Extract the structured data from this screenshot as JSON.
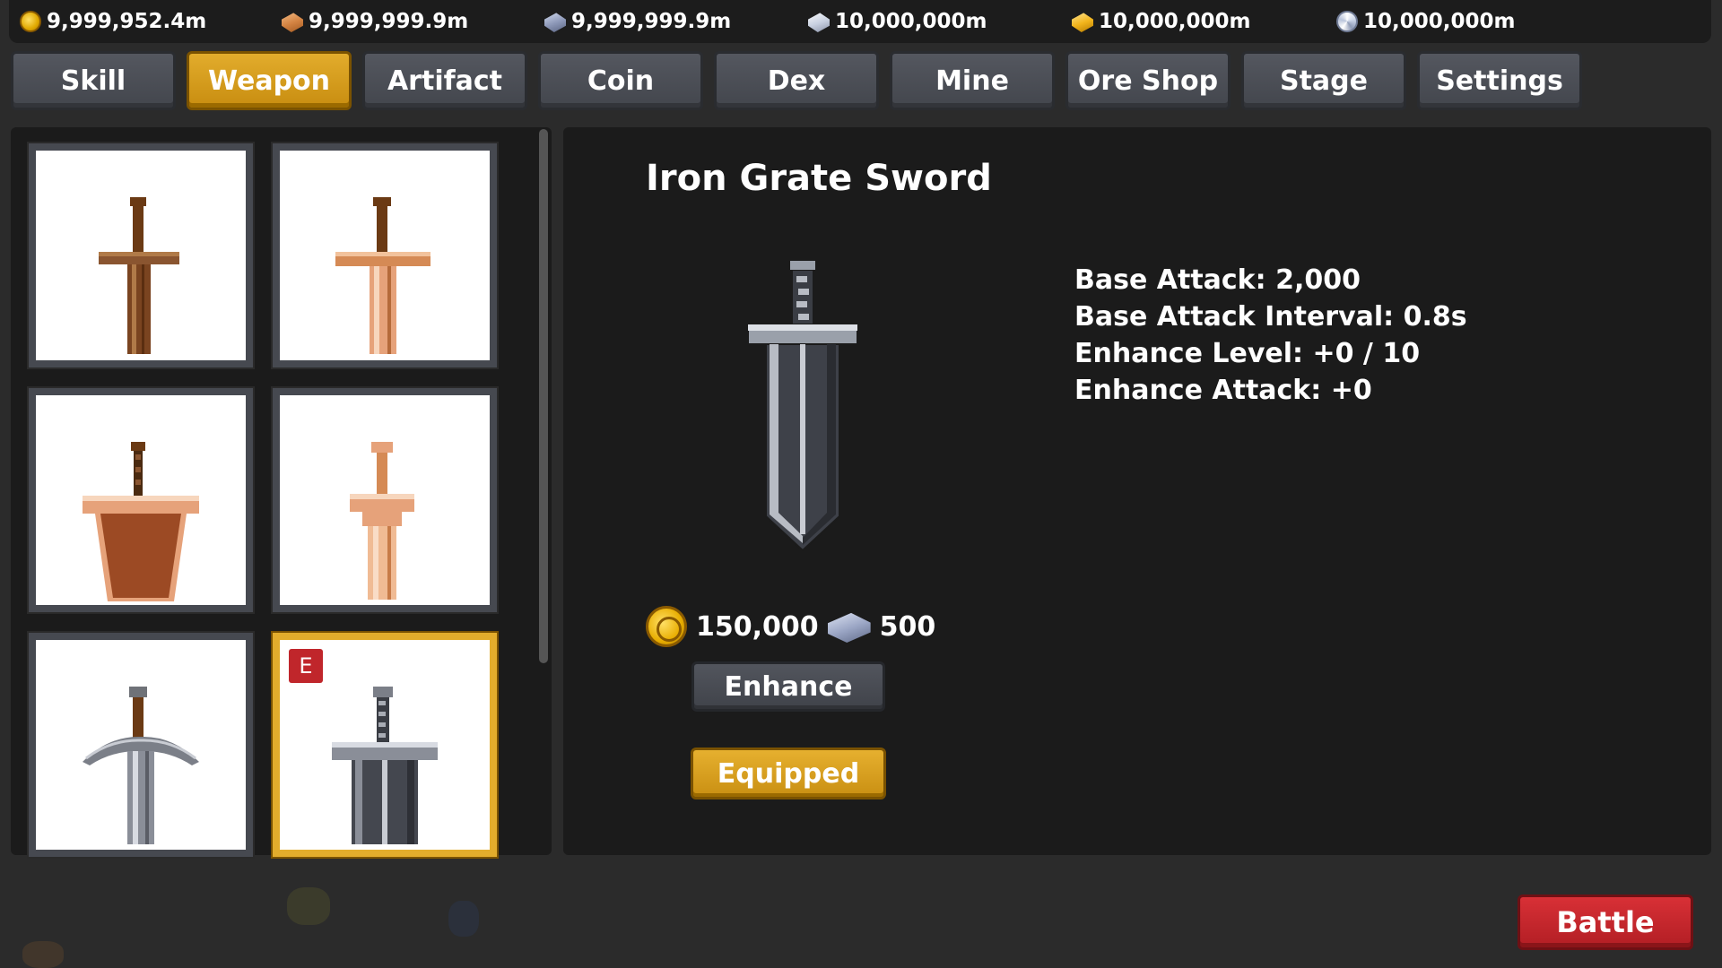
{
  "resources": [
    {
      "icon": "coin-icon",
      "value": "9,999,952.4m"
    },
    {
      "icon": "copper-ore-icon",
      "value": "9,999,999.9m"
    },
    {
      "icon": "iron-ore-icon",
      "value": "9,999,999.9m"
    },
    {
      "icon": "silver-ore-icon",
      "value": "10,000,000m"
    },
    {
      "icon": "gold-ore-icon",
      "value": "10,000,000m"
    },
    {
      "icon": "diamond-icon",
      "value": "10,000,000m"
    }
  ],
  "tabs": [
    {
      "label": "Skill",
      "active": false
    },
    {
      "label": "Weapon",
      "active": true
    },
    {
      "label": "Artifact",
      "active": false
    },
    {
      "label": "Coin",
      "active": false
    },
    {
      "label": "Dex",
      "active": false
    },
    {
      "label": "Mine",
      "active": false
    },
    {
      "label": "Ore Shop",
      "active": false
    },
    {
      "label": "Stage",
      "active": false
    },
    {
      "label": "Settings",
      "active": false
    }
  ],
  "inventory": [
    {
      "icon": "wooden-sword-icon",
      "selected": false,
      "equipped": false
    },
    {
      "icon": "copper-sword-icon",
      "selected": false,
      "equipped": false
    },
    {
      "icon": "copper-broadsword-icon",
      "selected": false,
      "equipped": false
    },
    {
      "icon": "bronze-sword-icon",
      "selected": false,
      "equipped": false
    },
    {
      "icon": "iron-sword-icon",
      "selected": false,
      "equipped": false
    },
    {
      "icon": "iron-grate-sword-icon",
      "selected": true,
      "equipped": true,
      "badge": "E"
    }
  ],
  "detail": {
    "name": "Iron Grate Sword",
    "stats": [
      "Base Attack: 2,000",
      "Base Attack Interval: 0.8s",
      "Enhance Level: +0 / 10",
      "Enhance Attack: +0"
    ],
    "cost_coin": "150,000",
    "cost_iron": "500",
    "enhance_label": "Enhance",
    "equipped_label": "Equipped"
  },
  "battle_label": "Battle",
  "colors": {
    "accent_gold": "#e2ac2c",
    "battle_red": "#c8262c",
    "panel_bg": "#1b1b1b",
    "tab_bg": "#4b4e55"
  }
}
